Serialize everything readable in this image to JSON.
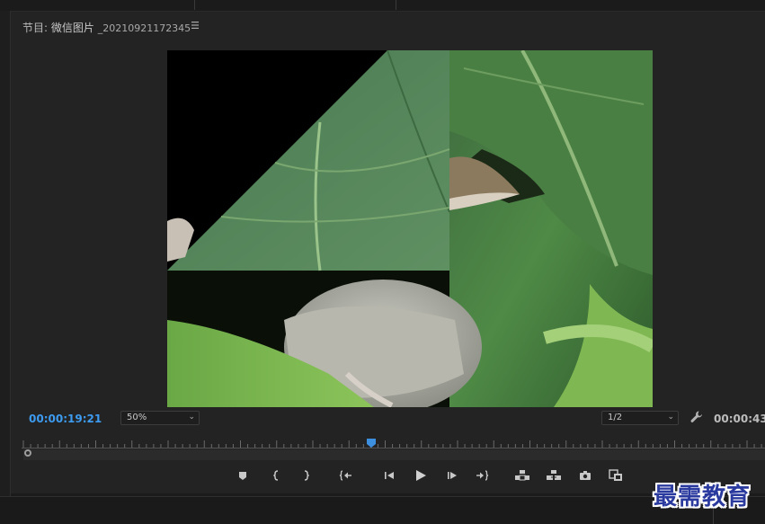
{
  "panel": {
    "label": "节目: ",
    "sequence_name": "微信图片",
    "clip_name": "_20210921172345",
    "menu_icon": "hamburger-menu-icon"
  },
  "timecodes": {
    "current": "00:00:19:21",
    "duration": "00:00:43"
  },
  "zoom_select": {
    "value": "50%"
  },
  "resolution_select": {
    "value": "1/2"
  },
  "playhead_progress": 0.47,
  "controls": [
    {
      "name": "add-marker-button",
      "icon": "marker-icon"
    },
    {
      "name": "mark-in-button",
      "icon": "mark-in-icon"
    },
    {
      "name": "mark-out-button",
      "icon": "mark-out-icon"
    },
    {
      "name": "go-to-in-button",
      "icon": "go-to-in-icon"
    },
    {
      "name": "step-back-button",
      "icon": "step-back-icon"
    },
    {
      "name": "play-button",
      "icon": "play-icon"
    },
    {
      "name": "step-forward-button",
      "icon": "step-forward-icon"
    },
    {
      "name": "go-to-out-button",
      "icon": "go-to-out-icon"
    },
    {
      "name": "lift-button",
      "icon": "lift-icon"
    },
    {
      "name": "extract-button",
      "icon": "extract-icon"
    },
    {
      "name": "export-frame-button",
      "icon": "camera-icon"
    },
    {
      "name": "comparison-view-button",
      "icon": "comparison-view-icon"
    }
  ],
  "colors": {
    "timecode_accent": "#3d9bf0",
    "playhead": "#3d8fe0"
  },
  "watermark": "最需教育"
}
